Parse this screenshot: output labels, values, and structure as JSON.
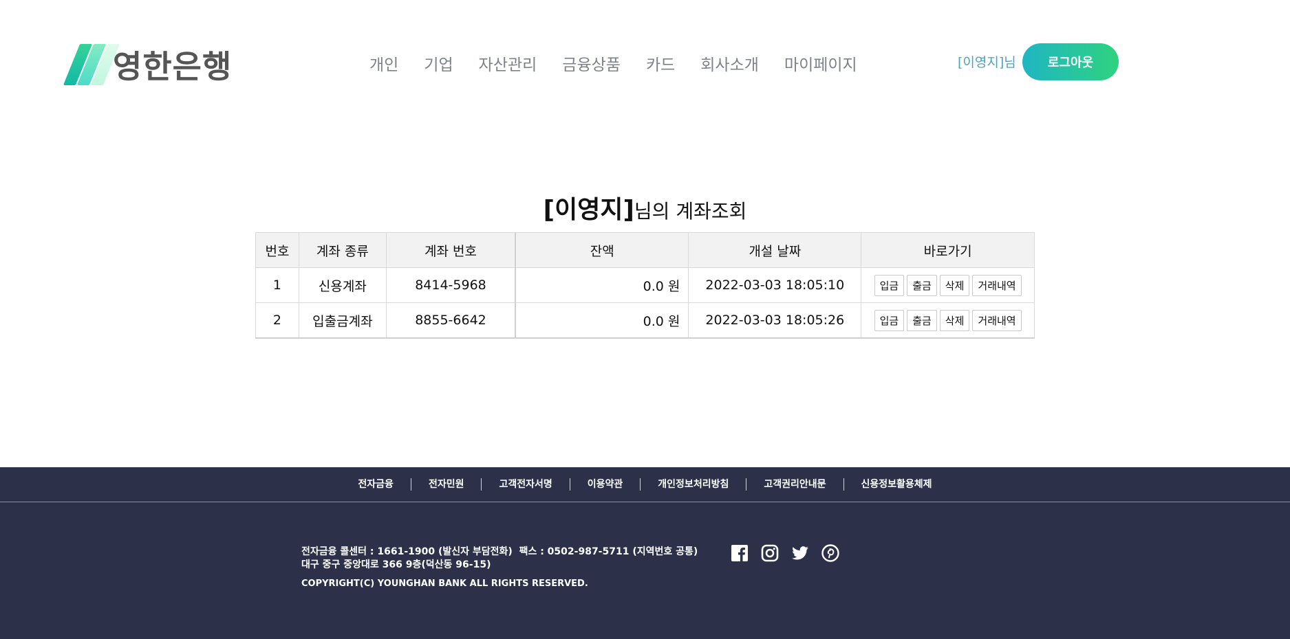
{
  "header": {
    "logo_text": "영한은행",
    "nav": [
      "개인",
      "기업",
      "자산관리",
      "금융상품",
      "카드",
      "회사소개",
      "마이페이지"
    ],
    "user_label": "[이영지]님",
    "logout_label": "로그아웃"
  },
  "title": {
    "name": "[이영지]",
    "suffix": "님의 계좌조회"
  },
  "table": {
    "headers": [
      "번호",
      "계좌 종류",
      "계좌 번호",
      "잔액",
      "개설 날짜",
      "바로가기"
    ],
    "rows": [
      {
        "no": "1",
        "type": "신용계좌",
        "number": "8414-5968",
        "balance": "0.0 원",
        "date": "2022-03-03 18:05:10"
      },
      {
        "no": "2",
        "type": "입출금계좌",
        "number": "8855-6642",
        "balance": "0.0 원",
        "date": "2022-03-03 18:05:26"
      }
    ],
    "actions": [
      "입금",
      "출금",
      "삭제",
      "거래내역"
    ]
  },
  "footer": {
    "links": [
      "전자금융",
      "전자민원",
      "고객전자서명",
      "이용약관",
      "개인정보처리방침",
      "고객권리안내문",
      "신용정보활용체제"
    ],
    "callcenter": "전자금융 콜센터 : 1661-1900 (발신자 부담전화)",
    "fax": "팩스 : 0502-987-5711 (지역번호 공통)",
    "address": "대구 중구 중앙대로 366 9층(덕산동 96-15)",
    "copyright": "COPYRIGHT(C) YOUNGHAN BANK ALL RIGHTS RESERVED.",
    "socials": [
      "facebook-icon",
      "instagram-icon",
      "twitter-icon",
      "pinterest-icon"
    ]
  },
  "colors": {
    "accent_start": "#1fb6c4",
    "accent_end": "#2fd27f",
    "footer_bg": "#2c3049",
    "user_text": "#4fa3b8"
  }
}
